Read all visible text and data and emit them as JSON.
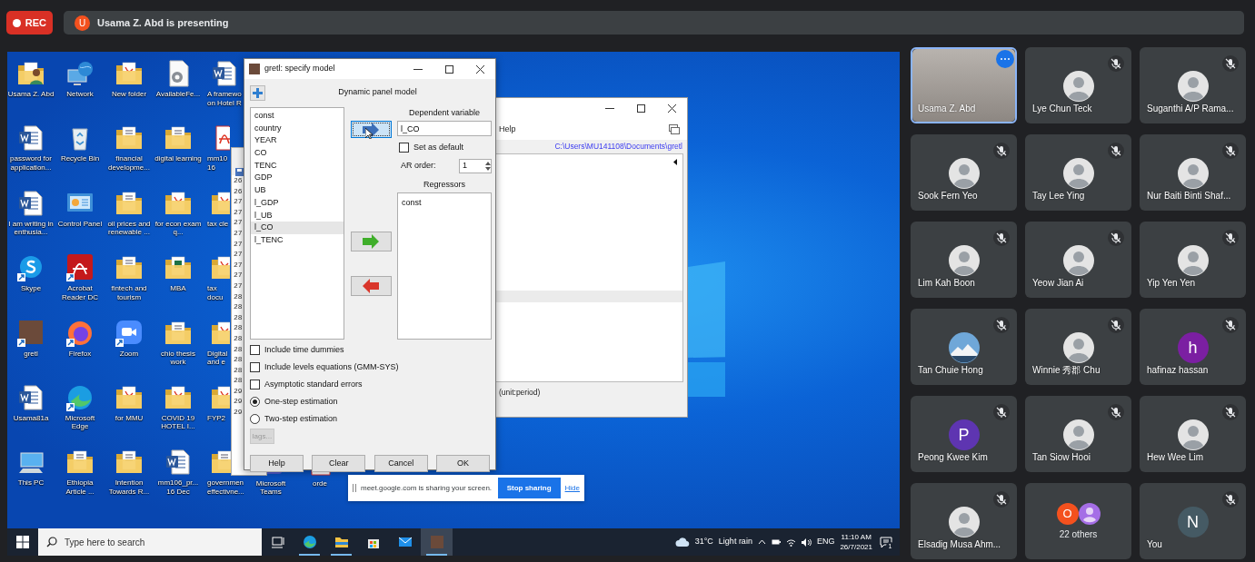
{
  "meeting": {
    "recording_label": "REC",
    "presenter_initial": "U",
    "presenting_text": "Usama Z. Abd is presenting"
  },
  "desktop": {
    "columns": [
      [
        {
          "label": "Usama Z. Abd",
          "kind": "user-folder",
          "shortcut": false
        },
        {
          "label": "password for application...",
          "kind": "word",
          "shortcut": false
        },
        {
          "label": "I am writing in enthusia...",
          "kind": "word",
          "shortcut": false
        },
        {
          "label": "Skype",
          "kind": "skype",
          "shortcut": true
        },
        {
          "label": "gretl",
          "kind": "photo",
          "shortcut": true
        },
        {
          "label": "Usama81a",
          "kind": "word",
          "shortcut": false
        },
        {
          "label": "This PC",
          "kind": "pc",
          "shortcut": false
        }
      ],
      [
        {
          "label": "Network",
          "kind": "network",
          "shortcut": false
        },
        {
          "label": "Recycle Bin",
          "kind": "recycle",
          "shortcut": false
        },
        {
          "label": "Control Panel",
          "kind": "control-panel",
          "shortcut": false
        },
        {
          "label": "Acrobat Reader DC",
          "kind": "acrobat",
          "shortcut": true
        },
        {
          "label": "Firefox",
          "kind": "firefox",
          "shortcut": true
        },
        {
          "label": "Microsoft Edge",
          "kind": "edge",
          "shortcut": true
        },
        {
          "label": "Ethiopia Article ...",
          "kind": "folder",
          "shortcut": false
        }
      ],
      [
        {
          "label": "New folder",
          "kind": "pdf-folder",
          "shortcut": false
        },
        {
          "label": "financial developme...",
          "kind": "folder",
          "shortcut": false
        },
        {
          "label": "oil prices and renewable ...",
          "kind": "folder",
          "shortcut": false
        },
        {
          "label": "fintech and tourism",
          "kind": "folder",
          "shortcut": false
        },
        {
          "label": "Zoom",
          "kind": "zoom",
          "shortcut": true
        },
        {
          "label": "for MMU",
          "kind": "pdf-folder",
          "shortcut": false
        },
        {
          "label": "Intention Towards R...",
          "kind": "folder",
          "shortcut": false
        }
      ],
      [
        {
          "label": "AvailableFe...",
          "kind": "gear-file",
          "shortcut": false
        },
        {
          "label": "digital learning",
          "kind": "folder",
          "shortcut": false
        },
        {
          "label": "for econ exam q...",
          "kind": "pdf-folder",
          "shortcut": false
        },
        {
          "label": "MBA",
          "kind": "excel-folder",
          "shortcut": false
        },
        {
          "label": "chio thesis work",
          "kind": "folder",
          "shortcut": false
        },
        {
          "label": "COVID 19 HOTEL I...",
          "kind": "pdf-folder",
          "shortcut": false
        },
        {
          "label": "mm106_pr... 16 Dec",
          "kind": "word",
          "shortcut": false
        }
      ],
      [
        {
          "label": "A framewo on Hotel R",
          "kind": "word",
          "shortcut": false
        },
        {
          "label": "mm10 16",
          "kind": "pdf",
          "shortcut": false
        },
        {
          "label": "tax cle",
          "kind": "pdf-folder",
          "shortcut": false
        },
        {
          "label": "tax docu",
          "kind": "pdf-folder",
          "shortcut": false
        },
        {
          "label": "Digital and e",
          "kind": "pdf-folder",
          "shortcut": false
        },
        {
          "label": "FYP2",
          "kind": "pdf-folder",
          "shortcut": false
        },
        {
          "label": "governmen effectivne...",
          "kind": "folder",
          "shortcut": false
        }
      ],
      [
        {
          "label": "Microsoft Teams",
          "kind": "teams",
          "shortcut": false
        }
      ],
      [
        {
          "label": "orde",
          "kind": "pdf",
          "shortcut": false
        }
      ]
    ]
  },
  "back_window": {
    "line_numbers": [
      "26",
      "26",
      "27",
      "27",
      "27",
      "27",
      "27",
      "27",
      "27",
      "27",
      "27",
      "28",
      "28",
      "28",
      "28",
      "28",
      "28",
      "28",
      "28",
      "28",
      "29",
      "29",
      "29"
    ]
  },
  "main_window": {
    "menu": "Help",
    "path": "C:\\Users\\MU141108\\Documents\\gretl",
    "status": "(unit:period)"
  },
  "dialog": {
    "title": "gretl: specify model",
    "heading": "Dynamic panel model",
    "variables": [
      {
        "label": "const",
        "selected": false
      },
      {
        "label": "country",
        "selected": false
      },
      {
        "label": "YEAR",
        "selected": false
      },
      {
        "label": "CO",
        "selected": false
      },
      {
        "label": "TENC",
        "selected": false
      },
      {
        "label": "GDP",
        "selected": false
      },
      {
        "label": "UB",
        "selected": false
      },
      {
        "label": "l_GDP",
        "selected": false
      },
      {
        "label": "l_UB",
        "selected": false
      },
      {
        "label": "l_CO",
        "selected": true
      },
      {
        "label": "l_TENC",
        "selected": false
      }
    ],
    "arrow_buttons": [
      {
        "kind": "blue-right",
        "focused": true
      },
      {
        "kind": "green-right",
        "focused": false
      },
      {
        "kind": "red-left",
        "focused": false
      }
    ],
    "dependent_label": "Dependent variable",
    "dependent_value": "l_CO",
    "set_default": {
      "label": "Set as default",
      "checked": false
    },
    "ar_order": {
      "label": "AR order:",
      "value": "1"
    },
    "regressors_label": "Regressors",
    "regressors": [
      "const"
    ],
    "options": [
      {
        "kind": "checkbox",
        "label": "Include time dummies",
        "checked": false
      },
      {
        "kind": "checkbox",
        "label": "Include levels equations (GMM-SYS)",
        "checked": false
      },
      {
        "kind": "checkbox",
        "label": "Asymptotic standard errors",
        "checked": false
      },
      {
        "kind": "radio",
        "label": "One-step estimation",
        "checked": true
      },
      {
        "kind": "radio",
        "label": "Two-step estimation",
        "checked": false
      }
    ],
    "lags_button": {
      "label": "lags...",
      "disabled": true
    },
    "buttons": [
      "Help",
      "Clear",
      "Cancel",
      "OK"
    ]
  },
  "share_bar": {
    "message": "meet.google.com is sharing your screen.",
    "stop_button": "Stop sharing",
    "hide_link": "Hide"
  },
  "taskbar": {
    "search_placeholder": "Type here to search",
    "apps": [
      {
        "kind": "task-view",
        "running": false,
        "selected": false
      },
      {
        "kind": "edge",
        "running": true,
        "selected": false
      },
      {
        "kind": "explorer",
        "running": true,
        "selected": false
      },
      {
        "kind": "store",
        "running": false,
        "selected": false
      },
      {
        "kind": "mail",
        "running": false,
        "selected": false
      },
      {
        "kind": "gretl",
        "running": true,
        "selected": true
      }
    ],
    "temperature": "31°C",
    "weather": "Light rain",
    "language": "ENG",
    "time": "11:10 AM",
    "date": "26/7/2021",
    "notifications": "1"
  },
  "participants": [
    {
      "name": "Usama Z. Abd",
      "kind": "video",
      "muted": false,
      "focused": true
    },
    {
      "name": "Lye Chun Teck",
      "kind": "photo",
      "muted": true,
      "focused": false
    },
    {
      "name": "Suganthi A/P Rama...",
      "kind": "photo",
      "muted": true,
      "focused": false
    },
    {
      "name": "Sook Fern Yeo",
      "kind": "photo",
      "muted": true,
      "focused": false
    },
    {
      "name": "Tay Lee Ying",
      "kind": "photo",
      "muted": true,
      "focused": false
    },
    {
      "name": "Nur Baiti Binti Shaf...",
      "kind": "photo",
      "muted": true,
      "focused": false
    },
    {
      "name": "Lim Kah Boon",
      "kind": "photo",
      "muted": true,
      "focused": false
    },
    {
      "name": "Yeow Jian Ai",
      "kind": "photo",
      "muted": true,
      "focused": false
    },
    {
      "name": "Yip Yen Yen",
      "kind": "photo",
      "muted": true,
      "focused": false
    },
    {
      "name": "Tan Chuie Hong",
      "kind": "landscape",
      "muted": true,
      "focused": false
    },
    {
      "name": "Winnie 秀郡 Chu",
      "kind": "photo",
      "muted": true,
      "focused": false
    },
    {
      "name": "hafinaz hassan",
      "kind": "initial",
      "initial": "h",
      "color": "#7b1fa2",
      "muted": true,
      "focused": false
    },
    {
      "name": "Peong Kwee Kim",
      "kind": "initial",
      "initial": "P",
      "color": "#5e35b1",
      "muted": true,
      "focused": false
    },
    {
      "name": "Tan Siow Hooi",
      "kind": "photo",
      "muted": true,
      "focused": false
    },
    {
      "name": "Hew Wee Lim",
      "kind": "photo",
      "muted": true,
      "focused": false
    },
    {
      "name": "Elsadig Musa Ahm...",
      "kind": "photo",
      "muted": true,
      "focused": false
    },
    {
      "name": "22 others",
      "kind": "others",
      "avatars": [
        {
          "kind": "initial",
          "initial": "O",
          "color": "#f4511e"
        },
        {
          "kind": "silhouette",
          "color": "#a56ee6"
        }
      ],
      "muted": false,
      "focused": false
    },
    {
      "name": "You",
      "kind": "initial",
      "initial": "N",
      "color": "#455a64",
      "muted": true,
      "focused": false
    }
  ]
}
